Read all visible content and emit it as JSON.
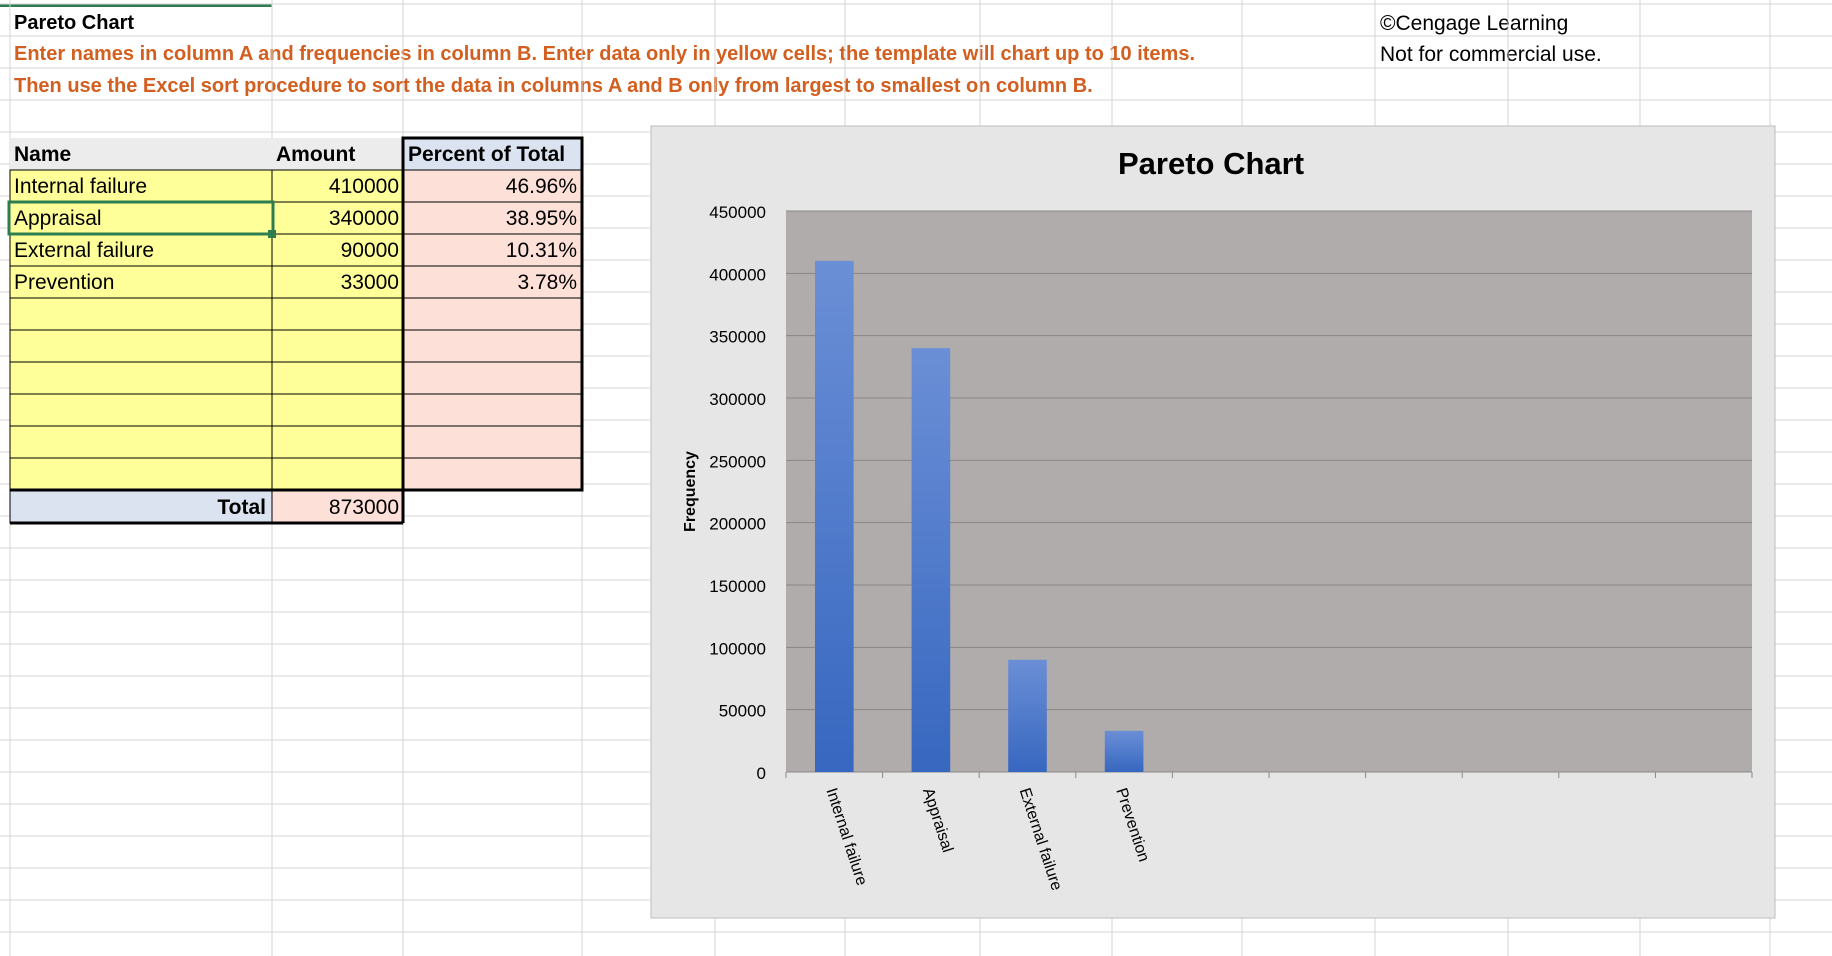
{
  "sheet": {
    "title": "Pareto Chart",
    "instruction_1": "Enter names in column A and frequencies in column B.  Enter data only in yellow cells; the template will chart up to 10 items.",
    "instruction_2": "Then use the Excel sort procedure to sort the data in columns A and B only from largest to smallest on column B.",
    "copyright": "©Cengage Learning",
    "notice": "Not for commercial use."
  },
  "table": {
    "headers": [
      "Name",
      "Amount",
      "Percent of Total"
    ],
    "rows": [
      {
        "name": "Internal failure",
        "amount": "410000",
        "percent": "46.96%"
      },
      {
        "name": "Appraisal",
        "amount": "340000",
        "percent": "38.95%"
      },
      {
        "name": "External failure",
        "amount": "90000",
        "percent": "10.31%"
      },
      {
        "name": "Prevention",
        "amount": "33000",
        "percent": "3.78%"
      },
      {
        "name": "",
        "amount": "",
        "percent": ""
      },
      {
        "name": "",
        "amount": "",
        "percent": ""
      },
      {
        "name": "",
        "amount": "",
        "percent": ""
      },
      {
        "name": "",
        "amount": "",
        "percent": ""
      },
      {
        "name": "",
        "amount": "",
        "percent": ""
      },
      {
        "name": "",
        "amount": "",
        "percent": ""
      }
    ],
    "total_label": "Total",
    "total_value": "873000"
  },
  "colors": {
    "yellow_cell": "#ffff99",
    "pink_cell": "#fde0d8",
    "header_fill": "#ececec",
    "total_fill": "#dbe3f1",
    "instruction": "#d25f20",
    "plot_bg": "#b0acab",
    "chart_bg": "#e6e6e6",
    "bar": "#4472c4"
  },
  "chart_data": {
    "type": "bar",
    "title": "Pareto Chart",
    "ylabel": "Frequency",
    "xlabel": "",
    "categories": [
      "Internal failure",
      "Appraisal",
      "External failure",
      "Prevention",
      "",
      "",
      "",
      "",
      "",
      ""
    ],
    "values": [
      410000,
      340000,
      90000,
      33000,
      null,
      null,
      null,
      null,
      null,
      null
    ],
    "ylim": [
      0,
      450000
    ],
    "yticks": [
      0,
      50000,
      100000,
      150000,
      200000,
      250000,
      300000,
      350000,
      400000,
      450000
    ],
    "grid": true,
    "legend": "none"
  }
}
